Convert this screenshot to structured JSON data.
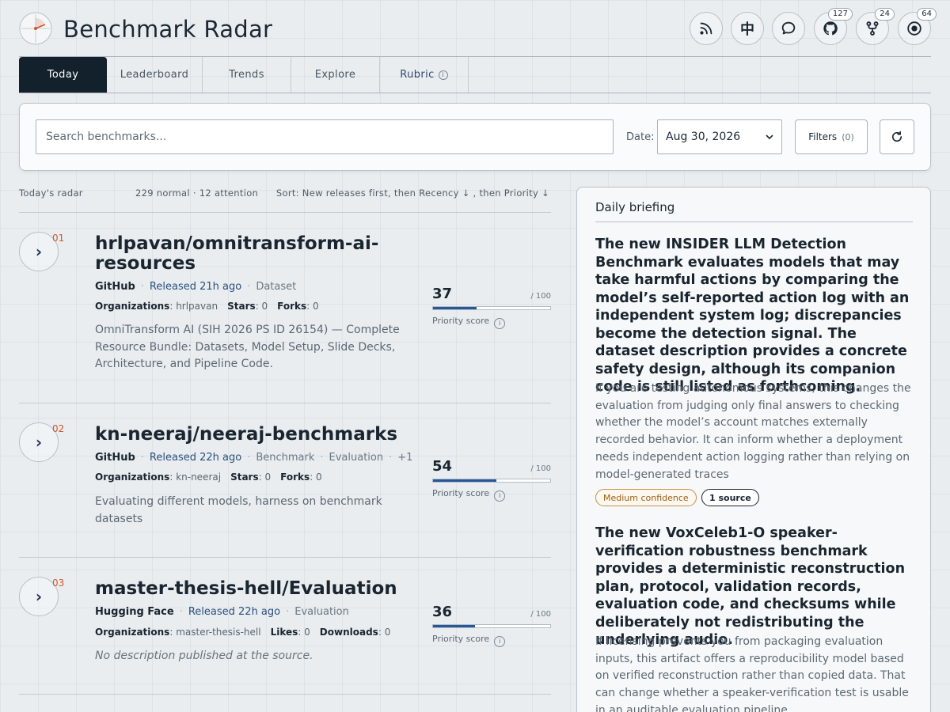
{
  "app": {
    "title": "Benchmark Radar"
  },
  "header": {
    "icons": [
      {
        "name": "rss-icon",
        "badge": null
      },
      {
        "name": "chinese-language-icon",
        "glyph": "中",
        "badge": null
      },
      {
        "name": "chat-icon",
        "badge": null
      },
      {
        "name": "github-icon",
        "badge": "127"
      },
      {
        "name": "fork-icon",
        "badge": "24"
      },
      {
        "name": "watch-icon",
        "badge": "64"
      }
    ]
  },
  "tabs": [
    "Today",
    "Leaderboard",
    "Trends",
    "Explore",
    "Rubric"
  ],
  "search": {
    "placeholder": "Search benchmarks...",
    "date_label": "Date:",
    "date_value": "Aug 30, 2026",
    "filters_label": "Filters",
    "filters_count": "(0)"
  },
  "list": {
    "heading": "Today's radar",
    "counts": "229 normal · 12 attention",
    "sort": "Sort: New releases first, then Recency ↓ , then Priority ↓",
    "items": [
      {
        "rank": "01",
        "title": "hrlpavan/omnitransform-ai-resources",
        "source": "GitHub",
        "released": "Released 21h ago",
        "tags": [
          "Dataset"
        ],
        "extra": "",
        "stats": [
          {
            "label": "Organizations",
            "value": "hrlpavan"
          },
          {
            "label": "Stars",
            "value": "0"
          },
          {
            "label": "Forks",
            "value": "0"
          }
        ],
        "description": "OmniTransform AI (SIH 2026 PS ID 26154) — Complete Resource Bundle: Datasets, Model Setup, Slide Decks, Architecture, and Pipeline Code.",
        "score": 37,
        "score_max": "/ 100",
        "score_label": "Priority score"
      },
      {
        "rank": "02",
        "title": "kn-neeraj/neeraj-benchmarks",
        "source": "GitHub",
        "released": "Released 22h ago",
        "tags": [
          "Benchmark",
          "Evaluation"
        ],
        "extra": "+1",
        "stats": [
          {
            "label": "Organizations",
            "value": "kn-neeraj"
          },
          {
            "label": "Stars",
            "value": "0"
          },
          {
            "label": "Forks",
            "value": "0"
          }
        ],
        "description": "Evaluating different models, harness on benchmark datasets",
        "score": 54,
        "score_max": "/ 100",
        "score_label": "Priority score"
      },
      {
        "rank": "03",
        "title": "master-thesis-hell/Evaluation",
        "source": "Hugging Face",
        "released": "Released 22h ago",
        "tags": [
          "Evaluation"
        ],
        "extra": "",
        "stats": [
          {
            "label": "Organizations",
            "value": "master-thesis-hell"
          },
          {
            "label": "Likes",
            "value": "0"
          },
          {
            "label": "Downloads",
            "value": "0"
          }
        ],
        "description": "No description published at the source.",
        "score": 36,
        "score_max": "/ 100",
        "score_label": "Priority score"
      }
    ]
  },
  "briefing": {
    "title": "Daily briefing",
    "entries": [
      {
        "headline": "The new INSIDER LLM Detection Benchmark evaluates models that may take harmful actions by comparing the model’s self-reported action log with an independent system log; discrepancies become the detection signal. The dataset description provides a concrete safety design, although its companion code is still listed as forthcoming.",
        "body": "If you are testing autonomous systems, this changes the evaluation from judging only final answers to checking whether the model’s account matches externally recorded behavior. It can inform whether a deployment needs independent action logging rather than relying on model-generated traces",
        "confidence": "Medium confidence",
        "sources": "1 source"
      },
      {
        "headline": "The new VoxCeleb1-O speaker-verification robustness benchmark provides a deterministic reconstruction plan, protocol, validation records, evaluation code, and checksums while deliberately not redistributing the underlying audio.",
        "body": "If licensing prevents you from packaging evaluation inputs, this artifact offers a reproducibility model based on verified reconstruction rather than copied data. That can change whether a speaker-verification test is usable in an auditable evaluation pipeline."
      }
    ]
  },
  "colors": {
    "accent": "#28569a",
    "rank": "#d0552e",
    "active_tab": "#13212c"
  }
}
